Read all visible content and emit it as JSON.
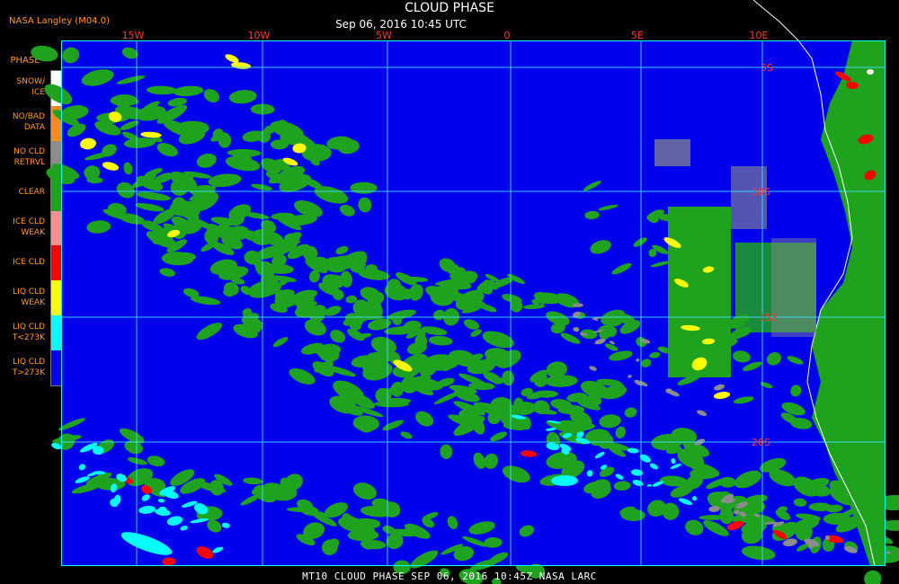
{
  "header": {
    "credit": "NASA Langley (M04.0)",
    "title": "CLOUD PHASE",
    "subtitle": "Sep 06, 2016 10:45 UTC"
  },
  "legend": {
    "title": "PHASE",
    "items": [
      {
        "label": "SNOW/\nICE",
        "color": "#ffffff"
      },
      {
        "label": "NO/BAD\nDATA",
        "color": "#ff8c1a"
      },
      {
        "label": "NO CLD\nRETRVL",
        "color": "#8c8c8c"
      },
      {
        "label": "CLEAR",
        "color": "#1fa31f"
      },
      {
        "label": "ICE CLD\nWEAK",
        "color": "#ff8f8f"
      },
      {
        "label": "ICE CLD",
        "color": "#ff0000"
      },
      {
        "label": "LIQ CLD\nWEAK",
        "color": "#ffff00"
      },
      {
        "label": "LIQ CLD\nT<273K",
        "color": "#00ffff"
      },
      {
        "label": "LIQ CLD\nT>273K",
        "color": "#0000ee"
      }
    ]
  },
  "map": {
    "background_color": "#0000ee",
    "grid_color": "#40e0ff",
    "lon_labels": [
      "15W",
      "10W",
      "5W",
      "0",
      "5E",
      "10E"
    ],
    "lat_labels": [
      "5S",
      "10S",
      "15S",
      "20S"
    ]
  },
  "footer": {
    "text": "MT10  CLOUD PHASE   SEP 06, 2016 10:45Z   NASA LARC"
  }
}
